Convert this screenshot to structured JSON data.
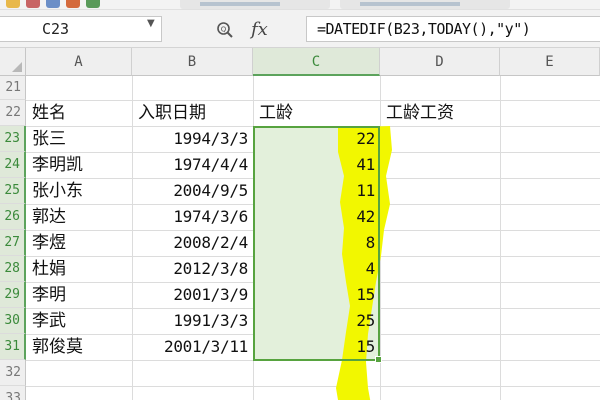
{
  "formula_bar": {
    "cell_ref": "C23",
    "fx_label": "fx",
    "formula": "=DATEDIF(B23,TODAY(),\"y\")"
  },
  "columns": [
    "A",
    "B",
    "C",
    "D",
    "E"
  ],
  "rows": [
    "21",
    "22",
    "23",
    "24",
    "25",
    "26",
    "27",
    "28",
    "29",
    "30",
    "31",
    "32",
    "33"
  ],
  "headers": {
    "name": "姓名",
    "hire_date": "入职日期",
    "seniority": "工龄",
    "seniority_pay": "工龄工资"
  },
  "employees": [
    {
      "name": "张三",
      "hire_date": "1994/3/3",
      "years": "22"
    },
    {
      "name": "李明凯",
      "hire_date": "1974/4/4",
      "years": "41"
    },
    {
      "name": "张小东",
      "hire_date": "2004/9/5",
      "years": "11"
    },
    {
      "name": "郭达",
      "hire_date": "1974/3/6",
      "years": "42"
    },
    {
      "name": "李煜",
      "hire_date": "2008/2/4",
      "years": "8"
    },
    {
      "name": "杜娟",
      "hire_date": "2012/3/8",
      "years": "4"
    },
    {
      "name": "李明",
      "hire_date": "2001/3/9",
      "years": "15"
    },
    {
      "name": "李武",
      "hire_date": "1991/3/3",
      "years": "25"
    },
    {
      "name": "郭俊莫",
      "hire_date": "2001/3/11",
      "years": "15"
    }
  ],
  "colors": {
    "selection_border": "#57a33f",
    "selection_fill": "#e3f0db",
    "highlighter": "#f2f700"
  }
}
